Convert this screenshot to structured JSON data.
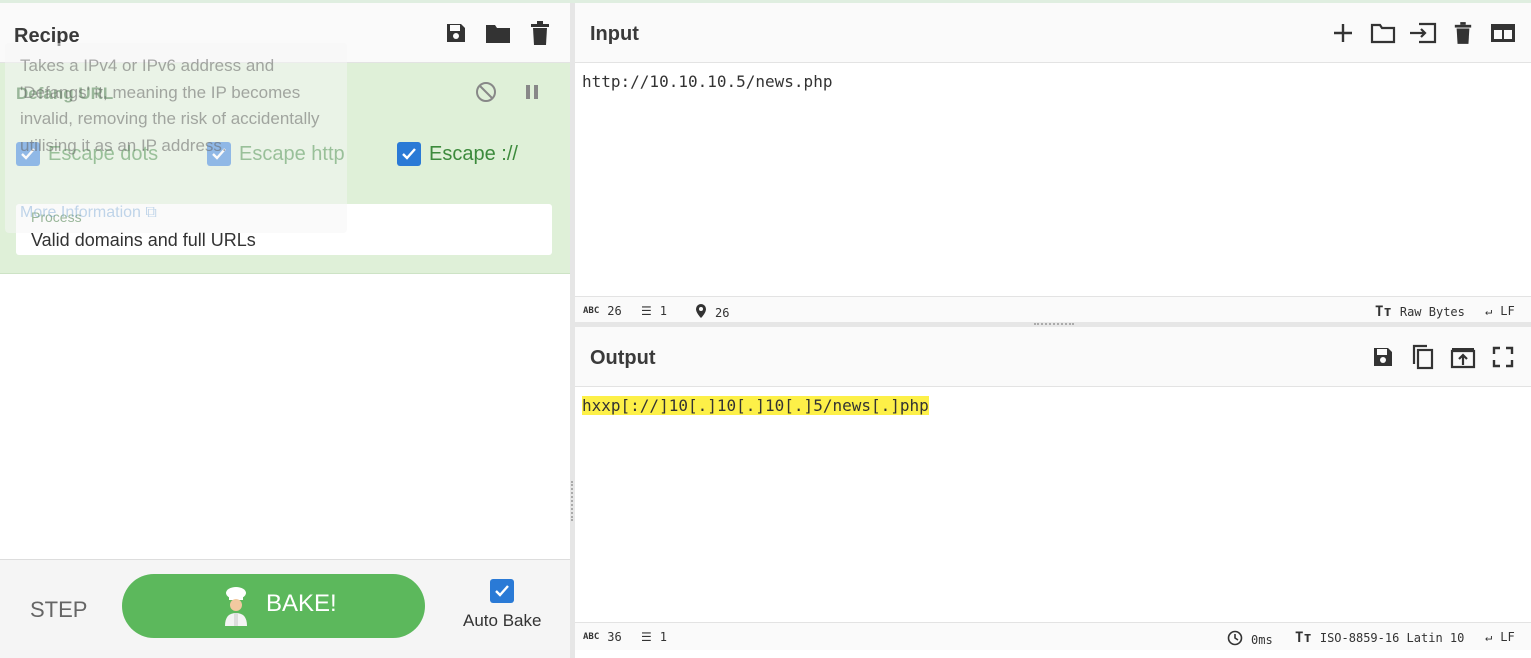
{
  "recipe": {
    "title": "Recipe",
    "operation": {
      "name": "Defang URL",
      "options": [
        {
          "label": "Escape dots",
          "checked": true
        },
        {
          "label": "Escape http",
          "checked": true
        },
        {
          "label": "Escape ://",
          "checked": true
        }
      ],
      "process_label": "Process",
      "process_value": "Valid domains and full URLs"
    },
    "tooltip": {
      "text": "Takes a IPv4 or IPv6 address and 'Defangs' it, meaning the IP becomes invalid, removing the risk of accidentally utilising it as an IP address.",
      "more": "More Information"
    }
  },
  "controls": {
    "step": "STEP",
    "bake": "BAKE!",
    "auto_bake": "Auto Bake",
    "auto_bake_checked": true
  },
  "input": {
    "title": "Input",
    "text": "http://10.10.10.5/news.php",
    "status": {
      "chars": "26",
      "lines": "1",
      "pos": "26",
      "encoding": "Raw Bytes",
      "eol": "LF"
    }
  },
  "output": {
    "title": "Output",
    "text": "hxxp[://]10[.]10[.]10[.]5/news[.]php",
    "status": {
      "chars": "36",
      "lines": "1",
      "time": "0ms",
      "encoding": "ISO-8859-16 Latin 10",
      "eol": "LF"
    }
  },
  "colors": {
    "accent_green": "#5cb85c",
    "op_bg": "#dff0d8",
    "checkbox_blue": "#2a7ad6",
    "highlight": "#fdf048"
  }
}
